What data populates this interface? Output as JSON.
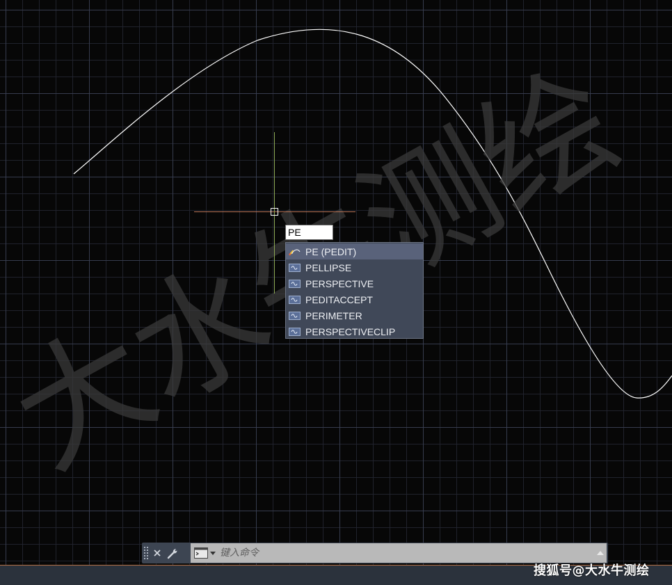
{
  "canvas": {
    "grid_major_color": "#3a4054",
    "grid_minor_color": "#222530",
    "background": "#070707",
    "curve_color": "#ffffff"
  },
  "watermark": {
    "text": "大水牛测绘",
    "color": "#3a3a3a"
  },
  "cursor": {
    "h_color": "#b77357",
    "v_color": "#8faa55"
  },
  "dynamic_input": {
    "value": "PE"
  },
  "autocomplete": {
    "items": [
      {
        "label": "PE (PEDIT)",
        "icon": "pedit-icon",
        "selected": true
      },
      {
        "label": "PELLIPSE",
        "icon": "command-icon",
        "selected": false
      },
      {
        "label": "PERSPECTIVE",
        "icon": "command-icon",
        "selected": false
      },
      {
        "label": "PEDITACCEPT",
        "icon": "command-icon",
        "selected": false
      },
      {
        "label": "PERIMETER",
        "icon": "command-icon",
        "selected": false
      },
      {
        "label": "PERSPECTIVECLIP",
        "icon": "command-icon",
        "selected": false
      }
    ]
  },
  "command_line": {
    "close_icon": "close-icon",
    "customize_icon": "wrench-icon",
    "prompt_icon": "command-prompt-icon",
    "placeholder": "键入命令"
  },
  "credit": {
    "text": "搜狐号@大水牛测绘"
  }
}
